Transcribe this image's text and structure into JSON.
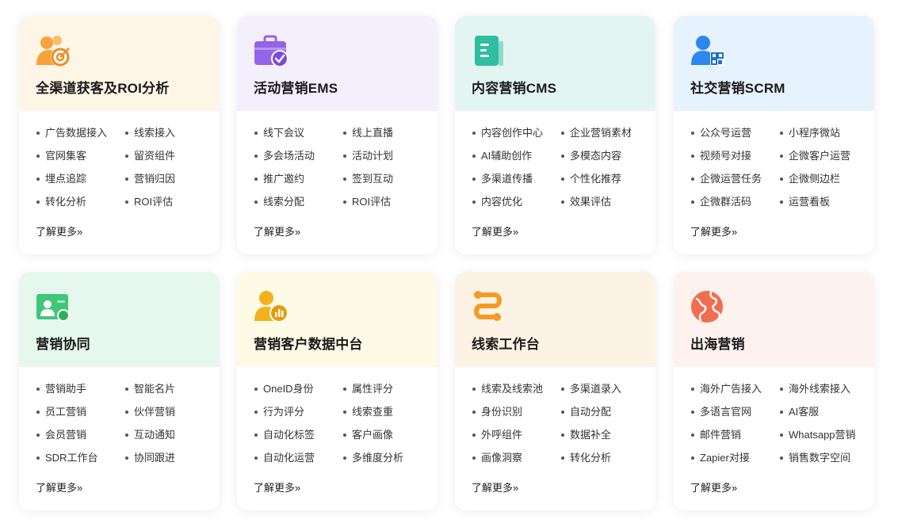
{
  "cards": [
    {
      "title": "全渠道获客及ROI分析",
      "head_bg": "#fdf5e6",
      "icon": "user-target-icon",
      "features": [
        "广告数据接入",
        "线索接入",
        "官网集客",
        "留资组件",
        "埋点追踪",
        "营销归因",
        "转化分析",
        "ROI评估"
      ],
      "more": "了解更多»"
    },
    {
      "title": "活动营销EMS",
      "head_bg": "#f4effd",
      "icon": "briefcase-check-icon",
      "features": [
        "线下会议",
        "线上直播",
        "多会场活动",
        "活动计划",
        "推广邀约",
        "签到互动",
        "线索分配",
        "ROI评估"
      ],
      "more": "了解更多»"
    },
    {
      "title": "内容营销CMS",
      "head_bg": "#e3f5f1",
      "icon": "document-icon",
      "features": [
        "内容创作中心",
        "企业营销素材",
        "AI辅助创作",
        "多模态内容",
        "多渠道传播",
        "个性化推荐",
        "内容优化",
        "效果评估"
      ],
      "more": "了解更多»"
    },
    {
      "title": "社交营销SCRM",
      "head_bg": "#e6f2fe",
      "icon": "user-qrcode-icon",
      "features": [
        "公众号运营",
        "小程序微站",
        "视频号对接",
        "企微客户运营",
        "企微运营任务",
        "企微侧边栏",
        "企微群活码",
        "运营看板"
      ],
      "more": "了解更多»"
    },
    {
      "title": "营销协同",
      "head_bg": "#e6f8ee",
      "icon": "team-card-icon",
      "features": [
        "营销助手",
        "智能名片",
        "员工营销",
        "伙伴营销",
        "会员营销",
        "互动通知",
        "SDR工作台",
        "协同跟进"
      ],
      "more": "了解更多»"
    },
    {
      "title": "营销客户数据中台",
      "head_bg": "#fdfbe6",
      "icon": "user-chart-icon",
      "features": [
        "OneID身份",
        "属性评分",
        "行为评分",
        "线索查重",
        "自动化标签",
        "客户画像",
        "自动化运营",
        "多维度分析"
      ],
      "more": "了解更多»"
    },
    {
      "title": "线索工作台",
      "head_bg": "#fdf3e4",
      "icon": "route-icon",
      "features": [
        "线索及线索池",
        "多渠道录入",
        "身份识别",
        "自动分配",
        "外呼组件",
        "数据补全",
        "画像洞察",
        "转化分析"
      ],
      "more": "了解更多»"
    },
    {
      "title": "出海营销",
      "head_bg": "#fdf2ee",
      "icon": "globe-icon",
      "features": [
        "海外广告接入",
        "海外线索接入",
        "多语言官网",
        "AI客服",
        "邮件营销",
        "Whatsapp营销",
        "Zapier对接",
        "销售数字空间"
      ],
      "more": "了解更多»"
    }
  ]
}
